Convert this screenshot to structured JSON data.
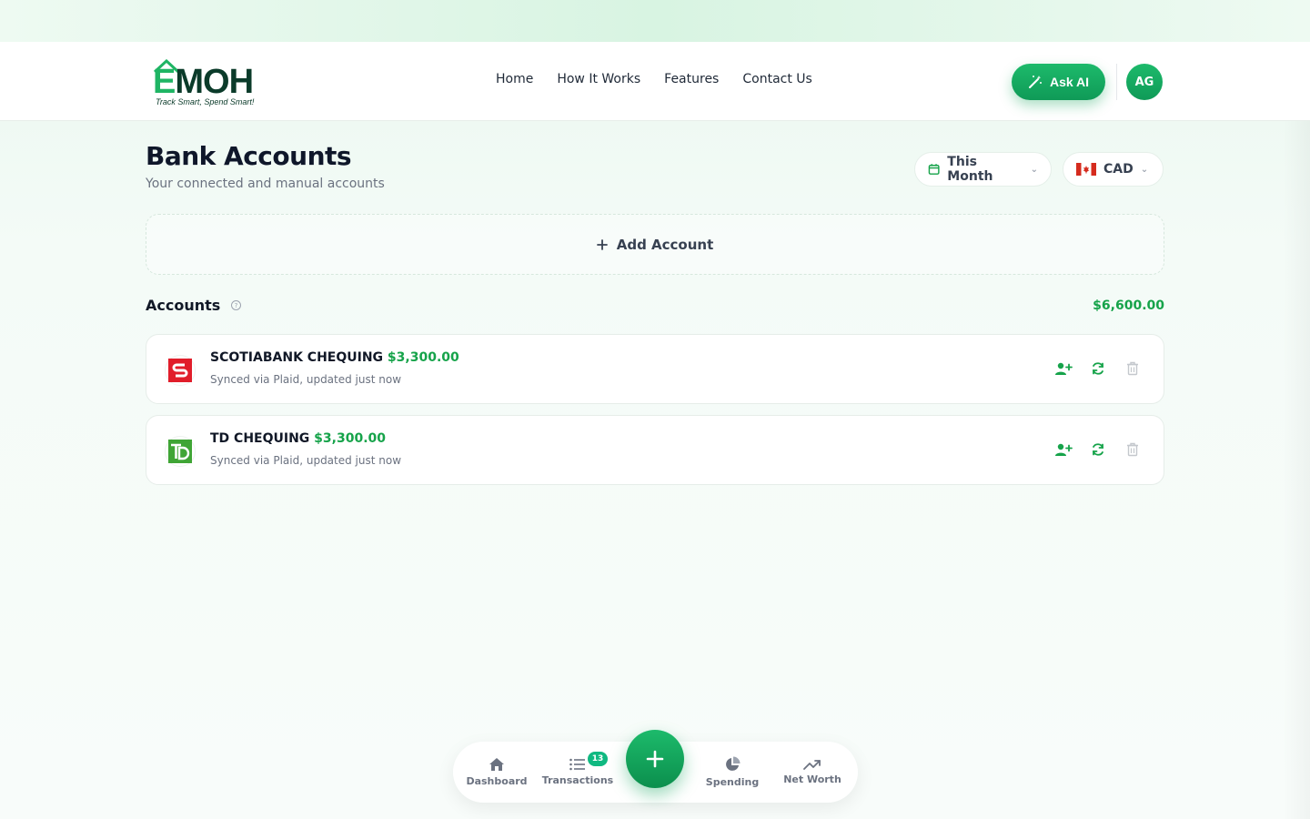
{
  "brand": {
    "name_prefix": "E",
    "name_rest": "MOH",
    "tagline": "Track Smart, Spend Smart!"
  },
  "nav": {
    "links": [
      "Home",
      "How It Works",
      "Features",
      "Contact Us"
    ],
    "ask_ai_label": "Ask AI",
    "avatar_initials": "AG"
  },
  "page": {
    "title": "Bank Accounts",
    "subtitle": "Your connected and manual accounts"
  },
  "filters": {
    "period": "This Month",
    "currency": "CAD"
  },
  "add_account_label": "Add Account",
  "accounts_section": {
    "title": "Accounts",
    "total": "$6,600.00",
    "items": [
      {
        "name": "SCOTIABANK CHEQUING",
        "amount": "$3,300.00",
        "sync_status": "Synced via Plaid, updated just now",
        "bank_icon": "scotiabank-logo-icon"
      },
      {
        "name": "TD CHEQUING",
        "amount": "$3,300.00",
        "sync_status": "Synced via Plaid, updated just now",
        "bank_icon": "td-logo-icon"
      }
    ]
  },
  "bottom_nav": {
    "dashboard": "Dashboard",
    "transactions": "Transactions",
    "transactions_badge": "13",
    "spending": "Spending",
    "net_worth": "Net Worth"
  },
  "colors": {
    "accent": "#16a34a",
    "accent_gradient_start": "#1dba6b",
    "accent_gradient_end": "#0f9a57",
    "scotiabank_red": "#e11d2a",
    "td_green": "#3fa535"
  }
}
